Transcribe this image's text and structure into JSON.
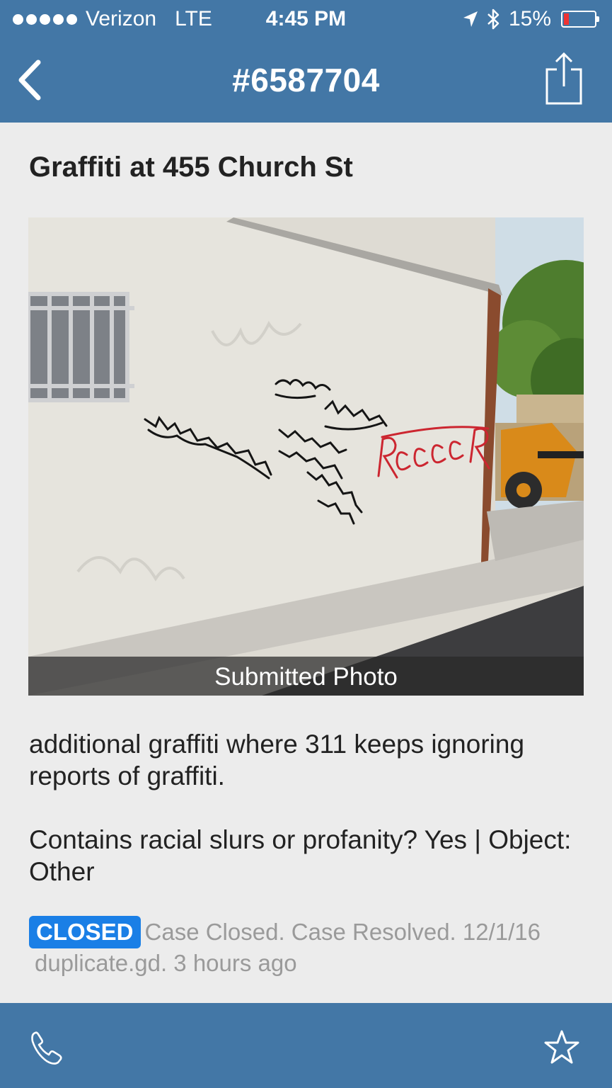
{
  "status_bar": {
    "carrier": "Verizon",
    "network": "LTE",
    "time": "4:45 PM",
    "battery": "15%",
    "signal_icon": "signal-dots-icon",
    "location_icon": "location-arrow-icon",
    "bluetooth_icon": "bluetooth-icon"
  },
  "nav": {
    "title": "#6587704",
    "back_icon": "chevron-left-icon",
    "share_icon": "share-icon"
  },
  "report": {
    "title": "Graffiti at 455 Church St",
    "photo_caption": "Submitted Photo",
    "description": "additional graffiti where 311 keeps ignoring reports of graffiti.",
    "details": "Contains racial slurs or profanity? Yes | Object: Other",
    "status_badge": "CLOSED",
    "status_text": "Case Closed. Case Resolved. 12/1/16",
    "status_sub": "duplicate.gd. 3 hours ago"
  },
  "toolbar": {
    "phone_icon": "phone-icon",
    "star_icon": "star-icon"
  },
  "colors": {
    "bar": "#4377a6",
    "background": "#ececec",
    "badge": "#1a7fe6",
    "battery_low": "#e33333"
  }
}
